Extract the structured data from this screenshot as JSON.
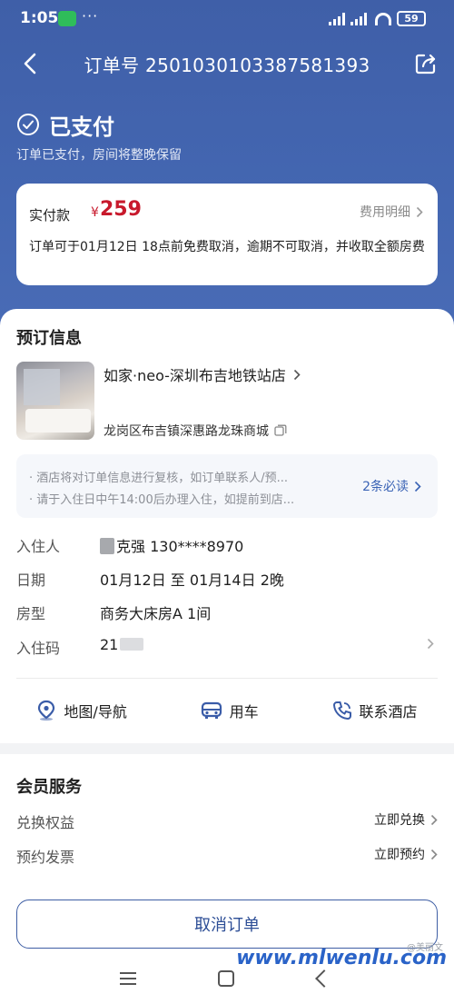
{
  "status_bar": {
    "time": "1:05",
    "dots": "···",
    "battery": "59"
  },
  "navbar": {
    "title": "订单号 2501030103387581393"
  },
  "order_status": {
    "title": "已支付",
    "description": "订单已支付，房间将整晚保留"
  },
  "payment": {
    "label": "实付款",
    "currency": "¥",
    "amount": "259",
    "detail_link": "费用明细",
    "cancel_policy": "订单可于01月12日 18点前免费取消，逾期不可取消，并收取全额房费"
  },
  "booking": {
    "section_title": "预订信息",
    "hotel_name": "如家·neo-深圳布吉地铁站店",
    "hotel_address": "龙岗区布吉镇深惠路龙珠商城",
    "notices": [
      "· 酒店将对订单信息进行复核，如订单联系人/预...",
      "· 请于入住日中午14:00后办理入住，如提前到店..."
    ],
    "notices_more": "2条必读",
    "rows": [
      {
        "label": "入住人",
        "value": "克强 130****8970"
      },
      {
        "label": "日期",
        "value": "01月12日 至 01月14日 2晚"
      },
      {
        "label": "房型",
        "value": "商务大床房A 1间"
      },
      {
        "label": "入住码",
        "value": "21"
      }
    ],
    "actions": [
      {
        "label": "地图/导航",
        "icon": "map-pin-icon"
      },
      {
        "label": "用车",
        "icon": "car-icon"
      },
      {
        "label": "联系酒店",
        "icon": "phone-icon"
      }
    ]
  },
  "member": {
    "section_title": "会员服务",
    "rows": [
      {
        "label": "兑换权益",
        "action": "立即兑换"
      },
      {
        "label": "预约发票",
        "action": "立即预约"
      }
    ]
  },
  "bottom": {
    "cancel_button": "取消订单"
  },
  "watermark": {
    "small": "@美丽文",
    "large": "www.mlwenlu.com"
  },
  "colors": {
    "header_blue": "#4467b2",
    "price_red": "#c8192c",
    "link_blue": "#3a63b5"
  }
}
